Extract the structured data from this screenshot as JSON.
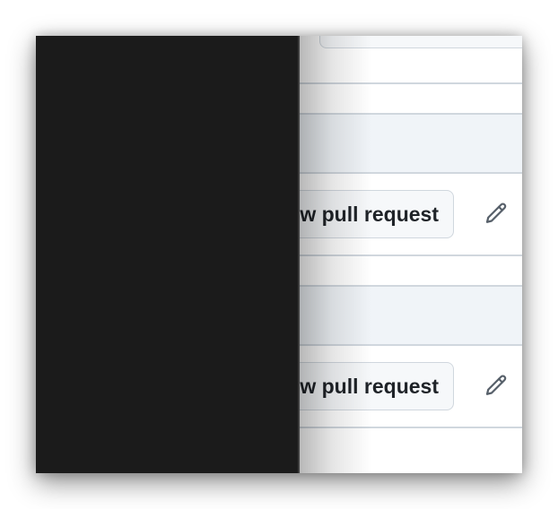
{
  "rows": [
    {
      "button_label": "New pull request",
      "edit_icon": "pencil-icon"
    },
    {
      "button_label": "New pull request",
      "edit_icon": "pencil-icon"
    }
  ],
  "colors": {
    "dark_panel": "#1b1b1b",
    "band": "#f0f4f8",
    "border": "#d0d7de",
    "button_bg": "#f6f8fa",
    "text": "#1f2328",
    "icon": "#57606a"
  }
}
